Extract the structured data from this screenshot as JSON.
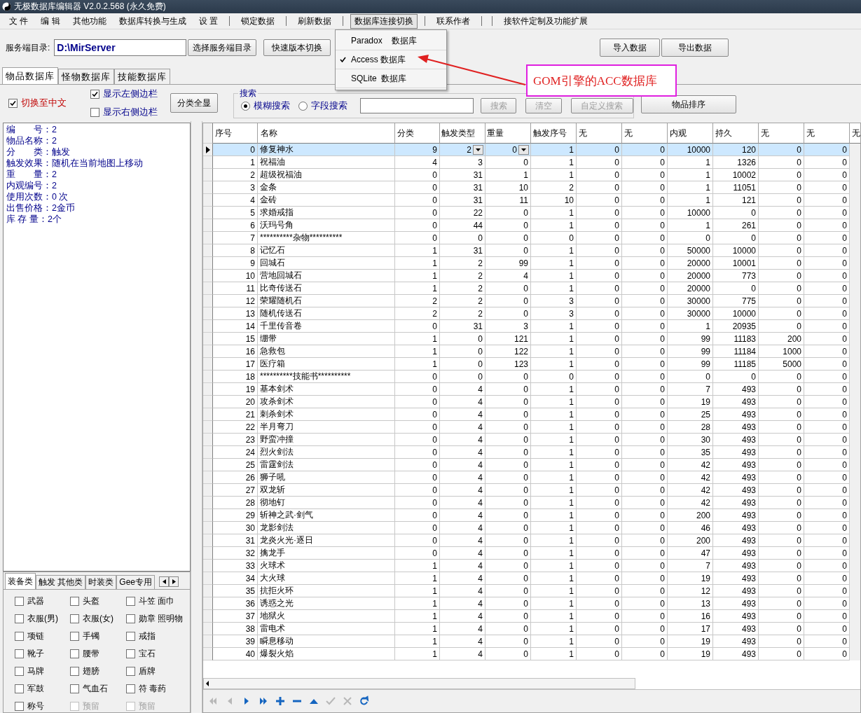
{
  "window": {
    "title": "无极数据库编辑器 V2.0.2.568 (永久免费)"
  },
  "menu": [
    {
      "kind": "item",
      "label": "文 件",
      "open": false
    },
    {
      "kind": "item",
      "label": "编 辑",
      "open": false
    },
    {
      "kind": "item",
      "label": "其他功能",
      "open": false
    },
    {
      "kind": "item",
      "label": "数据库转换与生成",
      "open": false
    },
    {
      "kind": "item",
      "label": "设 置",
      "open": false
    },
    {
      "kind": "separator"
    },
    {
      "kind": "item",
      "label": "锁定数据",
      "open": false
    },
    {
      "kind": "separator"
    },
    {
      "kind": "item",
      "label": "刷新数据",
      "open": false
    },
    {
      "kind": "separator"
    },
    {
      "kind": "item",
      "label": "数据库连接切换",
      "open": true
    },
    {
      "kind": "separator"
    },
    {
      "kind": "item",
      "label": "联系作者",
      "open": false
    },
    {
      "kind": "separator"
    },
    {
      "kind": "separator"
    },
    {
      "kind": "item",
      "label": "接软件定制及功能扩展",
      "open": false
    }
  ],
  "dropdown": {
    "items": [
      {
        "label": "Paradox    数据库",
        "checked": false
      },
      {
        "label": "Access 数据库",
        "checked": true
      },
      {
        "label": "SQLite  数据库",
        "checked": false
      }
    ]
  },
  "annotation": {
    "text": "GOM引擎的ACC数据库"
  },
  "server": {
    "label": "服务端目录:",
    "value": "D:\\MirServer",
    "buttons": [
      "选择服务端目录",
      "快速版本切换"
    ]
  },
  "data_buttons": [
    "导入数据",
    "导出数据"
  ],
  "db_tabs": [
    {
      "label": "物品数据库",
      "selected": true
    },
    {
      "label": "怪物数据库",
      "selected": false
    },
    {
      "label": "技能数据库",
      "selected": false
    }
  ],
  "options": [
    {
      "label": "切换至中文",
      "checked": true
    },
    {
      "label": "显示左侧边栏",
      "checked": true
    },
    {
      "label": "显示右侧边栏",
      "checked": false
    }
  ],
  "show_all_button": "分类全显",
  "search": {
    "title": "搜索",
    "modes": [
      {
        "label": "模糊搜索",
        "selected": true
      },
      {
        "label": "字段搜索",
        "selected": false
      }
    ],
    "buttons": [
      {
        "label": "搜索",
        "disabled": true
      },
      {
        "label": "清空",
        "disabled": true
      },
      {
        "label": "自定义搜索",
        "disabled": true
      }
    ]
  },
  "sort_button": "物品排序",
  "info_lines": [
    "编　　号：2",
    "物品名称：2",
    "分　　类：触发",
    "触发效果：随机在当前地图上移动",
    "重　　量：2",
    "内观编号：2",
    "使用次数：0 次",
    "出售价格：2金币",
    "库 存 量：2个"
  ],
  "category_tabs": [
    {
      "label": "装备类",
      "selected": true
    },
    {
      "label": "触发 其他类",
      "selected": false
    },
    {
      "label": "时装类",
      "selected": false
    },
    {
      "label": "Gee专用",
      "selected": false
    }
  ],
  "categories": [
    {
      "label": "武器",
      "checked": false,
      "disabled": false
    },
    {
      "label": "头盔",
      "checked": false,
      "disabled": false
    },
    {
      "label": "斗笠 面巾",
      "checked": false,
      "disabled": false
    },
    {
      "label": "衣服(男)",
      "checked": false,
      "disabled": false
    },
    {
      "label": "衣服(女)",
      "checked": false,
      "disabled": false
    },
    {
      "label": "勋章 照明物",
      "checked": false,
      "disabled": false
    },
    {
      "label": "项链",
      "checked": false,
      "disabled": false
    },
    {
      "label": "手镯",
      "checked": false,
      "disabled": false
    },
    {
      "label": "戒指",
      "checked": false,
      "disabled": false
    },
    {
      "label": "靴子",
      "checked": false,
      "disabled": false
    },
    {
      "label": "腰带",
      "checked": false,
      "disabled": false
    },
    {
      "label": "宝石",
      "checked": false,
      "disabled": false
    },
    {
      "label": "马牌",
      "checked": false,
      "disabled": false
    },
    {
      "label": "翅膀",
      "checked": false,
      "disabled": false
    },
    {
      "label": "盾牌",
      "checked": false,
      "disabled": false
    },
    {
      "label": "军鼓",
      "checked": false,
      "disabled": false
    },
    {
      "label": "气血石",
      "checked": false,
      "disabled": false
    },
    {
      "label": "符 毒药",
      "checked": false,
      "disabled": false
    },
    {
      "label": "称号",
      "checked": false,
      "disabled": false
    },
    {
      "label": "预留",
      "checked": false,
      "disabled": true
    },
    {
      "label": "预留",
      "checked": false,
      "disabled": true
    }
  ],
  "table": {
    "columns": [
      {
        "label": "序号",
        "kind": "number"
      },
      {
        "label": "名称",
        "kind": "name"
      },
      {
        "label": "分类",
        "kind": "number"
      },
      {
        "label": "触发类型",
        "kind": "combo"
      },
      {
        "label": "重量",
        "kind": "combo"
      },
      {
        "label": "触发序号",
        "kind": "number"
      },
      {
        "label": "无",
        "kind": "number"
      },
      {
        "label": "无",
        "kind": "number"
      },
      {
        "label": "内观",
        "kind": "number"
      },
      {
        "label": "持久",
        "kind": "number"
      },
      {
        "label": "无",
        "kind": "number"
      },
      {
        "label": "无",
        "kind": "number"
      },
      {
        "label": "无",
        "kind": "number"
      }
    ],
    "rows": [
      {
        "selected": true,
        "cells": [
          "0",
          "修复神水",
          "9",
          "2",
          "0",
          "1",
          "0",
          "0",
          "10000",
          "120",
          "0",
          "0"
        ]
      },
      {
        "selected": false,
        "cells": [
          "1",
          "祝福油",
          "4",
          "3",
          "0",
          "1",
          "0",
          "0",
          "1",
          "1326",
          "0",
          "0"
        ]
      },
      {
        "selected": false,
        "cells": [
          "2",
          "超级祝福油",
          "0",
          "31",
          "1",
          "1",
          "0",
          "0",
          "1",
          "10002",
          "0",
          "0"
        ]
      },
      {
        "selected": false,
        "cells": [
          "3",
          "金条",
          "0",
          "31",
          "10",
          "2",
          "0",
          "0",
          "1",
          "11051",
          "0",
          "0"
        ]
      },
      {
        "selected": false,
        "cells": [
          "4",
          "金砖",
          "0",
          "31",
          "11",
          "10",
          "0",
          "0",
          "1",
          "121",
          "0",
          "0"
        ]
      },
      {
        "selected": false,
        "cells": [
          "5",
          "求婚戒指",
          "0",
          "22",
          "0",
          "1",
          "0",
          "0",
          "10000",
          "0",
          "0",
          "0"
        ]
      },
      {
        "selected": false,
        "cells": [
          "6",
          "沃玛号角",
          "0",
          "44",
          "0",
          "1",
          "0",
          "0",
          "1",
          "261",
          "0",
          "0"
        ]
      },
      {
        "selected": false,
        "cells": [
          "7",
          "**********杂物**********",
          "0",
          "0",
          "0",
          "0",
          "0",
          "0",
          "0",
          "0",
          "0",
          "0"
        ]
      },
      {
        "selected": false,
        "cells": [
          "8",
          "记忆石",
          "1",
          "31",
          "0",
          "1",
          "0",
          "0",
          "50000",
          "10000",
          "0",
          "0"
        ]
      },
      {
        "selected": false,
        "cells": [
          "9",
          "回城石",
          "1",
          "2",
          "99",
          "1",
          "0",
          "0",
          "20000",
          "10001",
          "0",
          "0"
        ]
      },
      {
        "selected": false,
        "cells": [
          "10",
          "营地回城石",
          "1",
          "2",
          "4",
          "1",
          "0",
          "0",
          "20000",
          "773",
          "0",
          "0"
        ]
      },
      {
        "selected": false,
        "cells": [
          "11",
          "比奇传送石",
          "1",
          "2",
          "0",
          "1",
          "0",
          "0",
          "20000",
          "0",
          "0",
          "0"
        ]
      },
      {
        "selected": false,
        "cells": [
          "12",
          "荣耀随机石",
          "2",
          "2",
          "0",
          "3",
          "0",
          "0",
          "30000",
          "775",
          "0",
          "0"
        ]
      },
      {
        "selected": false,
        "cells": [
          "13",
          "随机传送石",
          "2",
          "2",
          "0",
          "3",
          "0",
          "0",
          "30000",
          "10000",
          "0",
          "0"
        ]
      },
      {
        "selected": false,
        "cells": [
          "14",
          "千里传音卷",
          "0",
          "31",
          "3",
          "1",
          "0",
          "0",
          "1",
          "20935",
          "0",
          "0"
        ]
      },
      {
        "selected": false,
        "cells": [
          "15",
          "绷带",
          "1",
          "0",
          "121",
          "1",
          "0",
          "0",
          "99",
          "11183",
          "200",
          "0"
        ]
      },
      {
        "selected": false,
        "cells": [
          "16",
          "急救包",
          "1",
          "0",
          "122",
          "1",
          "0",
          "0",
          "99",
          "11184",
          "1000",
          "0"
        ]
      },
      {
        "selected": false,
        "cells": [
          "17",
          "医疗箱",
          "1",
          "0",
          "123",
          "1",
          "0",
          "0",
          "99",
          "11185",
          "5000",
          "0"
        ]
      },
      {
        "selected": false,
        "cells": [
          "18",
          "**********技能书**********",
          "0",
          "0",
          "0",
          "0",
          "0",
          "0",
          "0",
          "0",
          "0",
          "0"
        ]
      },
      {
        "selected": false,
        "cells": [
          "19",
          "基本剑术",
          "0",
          "4",
          "0",
          "1",
          "0",
          "0",
          "7",
          "493",
          "0",
          "0"
        ]
      },
      {
        "selected": false,
        "cells": [
          "20",
          "攻杀剑术",
          "0",
          "4",
          "0",
          "1",
          "0",
          "0",
          "19",
          "493",
          "0",
          "0"
        ]
      },
      {
        "selected": false,
        "cells": [
          "21",
          "刺杀剑术",
          "0",
          "4",
          "0",
          "1",
          "0",
          "0",
          "25",
          "493",
          "0",
          "0"
        ]
      },
      {
        "selected": false,
        "cells": [
          "22",
          "半月弯刀",
          "0",
          "4",
          "0",
          "1",
          "0",
          "0",
          "28",
          "493",
          "0",
          "0"
        ]
      },
      {
        "selected": false,
        "cells": [
          "23",
          "野蛮冲撞",
          "0",
          "4",
          "0",
          "1",
          "0",
          "0",
          "30",
          "493",
          "0",
          "0"
        ]
      },
      {
        "selected": false,
        "cells": [
          "24",
          "烈火剑法",
          "0",
          "4",
          "0",
          "1",
          "0",
          "0",
          "35",
          "493",
          "0",
          "0"
        ]
      },
      {
        "selected": false,
        "cells": [
          "25",
          "雷霆剑法",
          "0",
          "4",
          "0",
          "1",
          "0",
          "0",
          "42",
          "493",
          "0",
          "0"
        ]
      },
      {
        "selected": false,
        "cells": [
          "26",
          "狮子吼",
          "0",
          "4",
          "0",
          "1",
          "0",
          "0",
          "42",
          "493",
          "0",
          "0"
        ]
      },
      {
        "selected": false,
        "cells": [
          "27",
          "双龙斩",
          "0",
          "4",
          "0",
          "1",
          "0",
          "0",
          "42",
          "493",
          "0",
          "0"
        ]
      },
      {
        "selected": false,
        "cells": [
          "28",
          "彻地钉",
          "0",
          "4",
          "0",
          "1",
          "0",
          "0",
          "42",
          "493",
          "0",
          "0"
        ]
      },
      {
        "selected": false,
        "cells": [
          "29",
          "斩神之武·剑气",
          "0",
          "4",
          "0",
          "1",
          "0",
          "0",
          "200",
          "493",
          "0",
          "0"
        ]
      },
      {
        "selected": false,
        "cells": [
          "30",
          "龙影剑法",
          "0",
          "4",
          "0",
          "1",
          "0",
          "0",
          "46",
          "493",
          "0",
          "0"
        ]
      },
      {
        "selected": false,
        "cells": [
          "31",
          "龙炎火光·逐日",
          "0",
          "4",
          "0",
          "1",
          "0",
          "0",
          "200",
          "493",
          "0",
          "0"
        ]
      },
      {
        "selected": false,
        "cells": [
          "32",
          "擒龙手",
          "0",
          "4",
          "0",
          "1",
          "0",
          "0",
          "47",
          "493",
          "0",
          "0"
        ]
      },
      {
        "selected": false,
        "cells": [
          "33",
          "火球术",
          "1",
          "4",
          "0",
          "1",
          "0",
          "0",
          "7",
          "493",
          "0",
          "0"
        ]
      },
      {
        "selected": false,
        "cells": [
          "34",
          "大火球",
          "1",
          "4",
          "0",
          "1",
          "0",
          "0",
          "19",
          "493",
          "0",
          "0"
        ]
      },
      {
        "selected": false,
        "cells": [
          "35",
          "抗拒火环",
          "1",
          "4",
          "0",
          "1",
          "0",
          "0",
          "12",
          "493",
          "0",
          "0"
        ]
      },
      {
        "selected": false,
        "cells": [
          "36",
          "诱惑之光",
          "1",
          "4",
          "0",
          "1",
          "0",
          "0",
          "13",
          "493",
          "0",
          "0"
        ]
      },
      {
        "selected": false,
        "cells": [
          "37",
          "地狱火",
          "1",
          "4",
          "0",
          "1",
          "0",
          "0",
          "16",
          "493",
          "0",
          "0"
        ]
      },
      {
        "selected": false,
        "cells": [
          "38",
          "雷电术",
          "1",
          "4",
          "0",
          "1",
          "0",
          "0",
          "17",
          "493",
          "0",
          "0"
        ]
      },
      {
        "selected": false,
        "cells": [
          "39",
          "瞬息移动",
          "1",
          "4",
          "0",
          "1",
          "0",
          "0",
          "19",
          "493",
          "0",
          "0"
        ]
      },
      {
        "selected": false,
        "cells": [
          "40",
          "爆裂火焰",
          "1",
          "4",
          "0",
          "1",
          "0",
          "0",
          "19",
          "493",
          "0",
          "0"
        ]
      }
    ]
  },
  "navigator": [
    {
      "kind": "first",
      "disabled": true
    },
    {
      "kind": "prior",
      "disabled": true
    },
    {
      "kind": "next",
      "disabled": false
    },
    {
      "kind": "last",
      "disabled": false
    },
    {
      "kind": "insert",
      "disabled": false
    },
    {
      "kind": "delete",
      "disabled": false
    },
    {
      "kind": "edit",
      "disabled": false
    },
    {
      "kind": "post",
      "disabled": true
    },
    {
      "kind": "cancel",
      "disabled": true
    },
    {
      "kind": "refresh",
      "disabled": false
    }
  ]
}
